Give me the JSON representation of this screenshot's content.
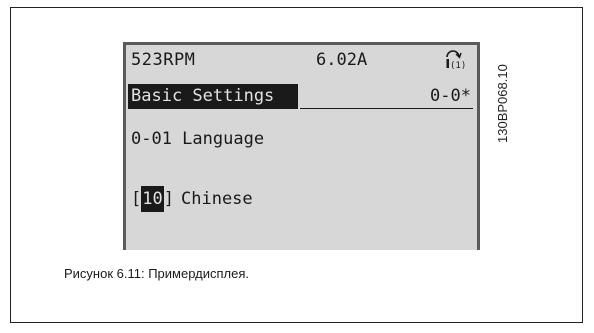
{
  "display": {
    "status": {
      "speed": "523RPM",
      "current": "6.02A",
      "setup_icon": "setup-1-icon"
    },
    "menu": {
      "title": "Basic Settings",
      "code": "0-0*"
    },
    "parameter": {
      "label": "0-01 Language"
    },
    "value": {
      "bracket_open": "[",
      "number": "10",
      "bracket_close": "]",
      "label": "Chinese"
    }
  },
  "figure_code": "130BP068.10",
  "caption": "Рисунок 6.11: Примердисплея.",
  "colors": {
    "lcd_background": "#d7d7d7",
    "lcd_frame": "#5a5a5a",
    "highlight": "#1a1a1a"
  }
}
